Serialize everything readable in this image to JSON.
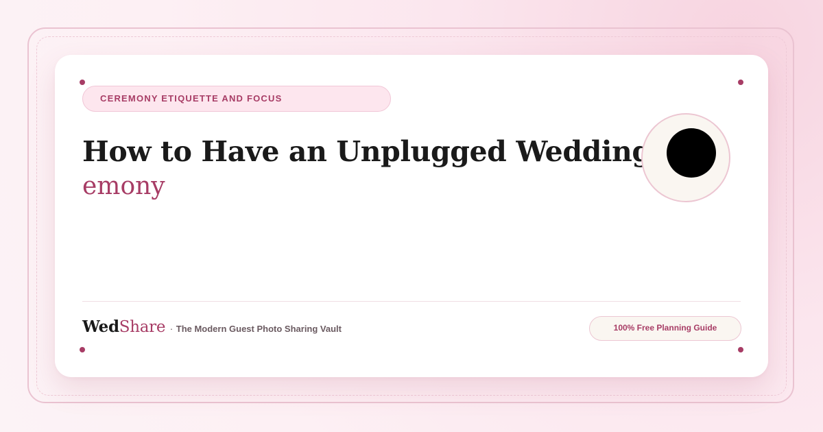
{
  "category": "Ceremony Etiquette and Focus",
  "title": {
    "line1": "How to Have an Unplugged Wedding Cer…",
    "line2": "emony"
  },
  "brand": {
    "name_part1": "Wed",
    "name_part2": "Share",
    "separator": "·",
    "tagline": "The Modern Guest Photo Sharing Vault"
  },
  "badge": "100% Free Planning Guide",
  "colors": {
    "accent": "#a73c65",
    "title": "#1a1a1a",
    "pill_bg": "#fde6ee",
    "badge_bg": "#faf6f1",
    "card": "#ffffff"
  }
}
